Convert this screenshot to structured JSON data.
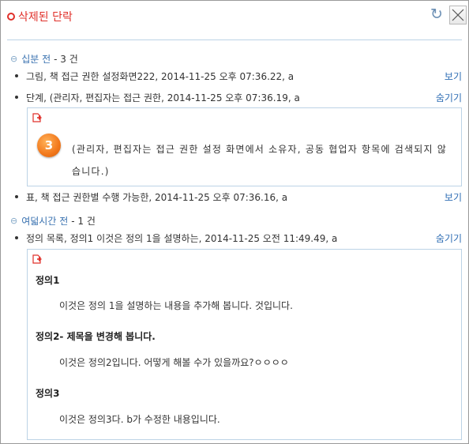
{
  "panel": {
    "title": "삭제된 단락",
    "refresh_icon": "refresh-icon",
    "close_icon": "close-icon"
  },
  "groups": [
    {
      "name": "십분 전",
      "count": "- 3 건",
      "items": [
        {
          "text": "그림, 책 접근 권한 설정화면222, 2014-11-25 오후 07:36.22, a",
          "action": "보기"
        },
        {
          "text": "단계, (관리자, 편집자는 접근 권한, 2014-11-25 오후 07:36.19, a",
          "action": "숨기기"
        },
        {
          "text": "표, 책 접근 권한별 수행 가능한, 2014-11-25 오후 07:36.16, a",
          "action": "보기"
        }
      ],
      "step_detail": {
        "number": "3",
        "text": "(관리자, 편집자는 접근 권한 설정 화면에서 소유자, 공동 협업자 항목에 검색되지 않습니다.)"
      }
    },
    {
      "name": "여덟시간 전",
      "count": "- 1 건",
      "items": [
        {
          "text": "정의 목록, 정의1 이것은 정의 1을 설명하는, 2014-11-25 오전 11:49.49, a",
          "action": "숨기기"
        }
      ],
      "definitions": [
        {
          "term": "정의1",
          "desc": "이것은 정의 1을 설명하는 내용을 추가해 봅니다. 것입니다."
        },
        {
          "term": "정의2- 제목을 변경해 봅니다.",
          "desc": "이것은 정의2입니다. 어떻게 해볼 수가 있을까요?ㅇㅇㅇㅇ"
        },
        {
          "term": "정의3",
          "desc": "이것은 정의3다. b가 수정한 내용입니다."
        }
      ]
    }
  ],
  "colors": {
    "title": "#e0302a",
    "group": "#3a72b0",
    "link": "#2e6db4",
    "border": "#bcd3e6",
    "badge": "#f2781c"
  }
}
